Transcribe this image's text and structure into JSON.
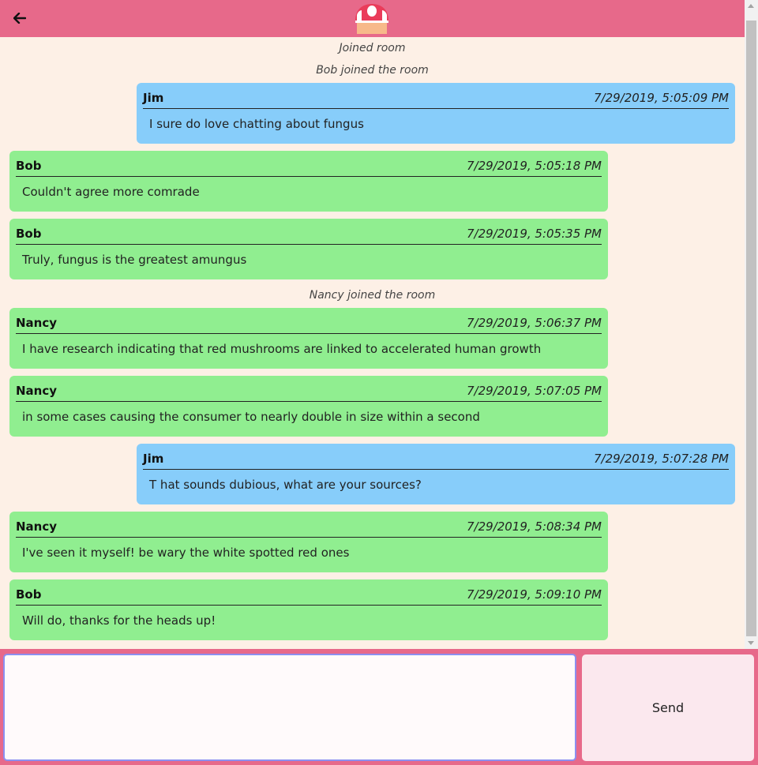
{
  "header": {
    "back_icon": "arrow-left-icon",
    "logo_icon": "mushroom-icon",
    "colors": {
      "bar": "#e7698a",
      "mushroom_cap": "#ea3c5a",
      "mushroom_stem": "#f7b98a"
    }
  },
  "chat": {
    "background": "#fdf0e6",
    "events": [
      {
        "text": "Joined room"
      },
      {
        "text": "Bob joined the room"
      },
      {
        "text": "Nancy joined the room"
      }
    ],
    "messages": [
      {
        "author": "Jim",
        "time": "7/29/2019, 5:05:09 PM",
        "text": "I sure do love chatting about fungus",
        "self": true
      },
      {
        "author": "Bob",
        "time": "7/29/2019, 5:05:18 PM",
        "text": "Couldn't agree more comrade",
        "self": false
      },
      {
        "author": "Bob",
        "time": "7/29/2019, 5:05:35 PM",
        "text": "Truly, fungus is the greatest amungus",
        "self": false
      },
      {
        "author": "Nancy",
        "time": "7/29/2019, 5:06:37 PM",
        "text": "I have research indicating that red mushrooms are linked to accelerated human growth",
        "self": false
      },
      {
        "author": "Nancy",
        "time": "7/29/2019, 5:07:05 PM",
        "text": "in some cases causing the consumer to nearly double in size within a second",
        "self": false
      },
      {
        "author": "Jim",
        "time": "7/29/2019, 5:07:28 PM",
        "text": "T hat sounds dubious, what are your sources?",
        "self": true
      },
      {
        "author": "Nancy",
        "time": "7/29/2019, 5:08:34 PM",
        "text": "I've seen it myself! be wary the white spotted red ones",
        "self": false
      },
      {
        "author": "Bob",
        "time": "7/29/2019, 5:09:10 PM",
        "text": "Will do, thanks for the heads up!",
        "self": false
      }
    ],
    "colors": {
      "self_bubble": "#87cdfa",
      "other_bubble": "#90ee90"
    }
  },
  "composer": {
    "input_value": "",
    "send_label": "Send"
  }
}
